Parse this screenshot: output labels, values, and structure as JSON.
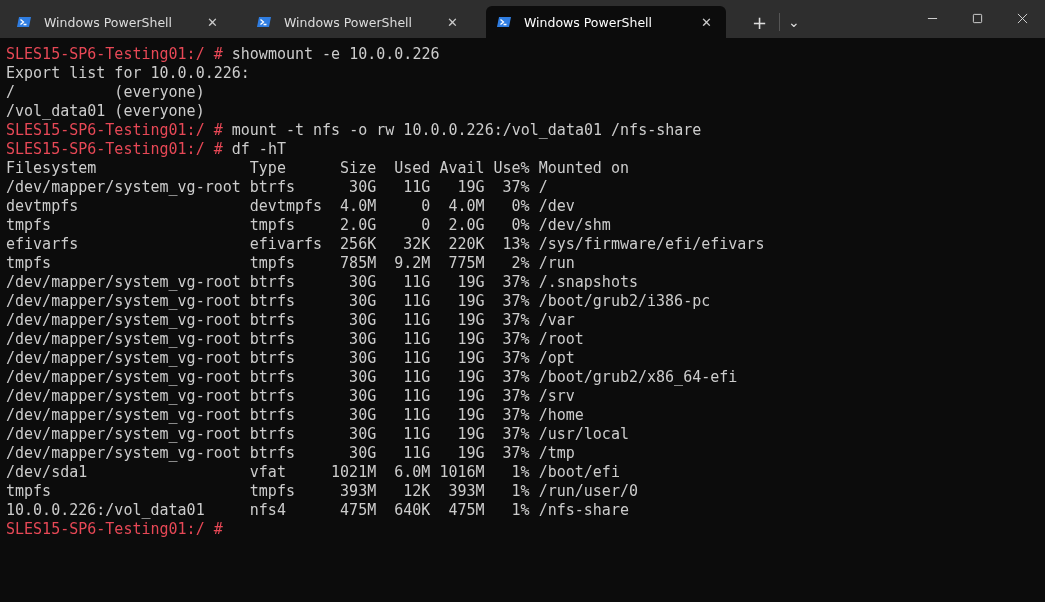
{
  "tabs": [
    {
      "title": "Windows PowerShell",
      "selected": false,
      "close": "✕"
    },
    {
      "title": "Windows PowerShell",
      "selected": false,
      "close": "✕"
    },
    {
      "title": "Windows PowerShell",
      "selected": true,
      "close": "✕"
    }
  ],
  "tab_actions": {
    "new_tab": "+",
    "dropdown": "⌄"
  },
  "terminal": {
    "before": [
      {
        "kind": "prompt",
        "prompt": "SLES15-SP6-Testing01:/ #",
        "command": "showmount -e 10.0.0.226"
      },
      {
        "kind": "output",
        "text": "Export list for 10.0.0.226:"
      },
      {
        "kind": "output",
        "text": "/           (everyone)"
      },
      {
        "kind": "output",
        "text": "/vol_data01 (everyone)"
      },
      {
        "kind": "prompt",
        "prompt": "SLES15-SP6-Testing01:/ #",
        "command": "mount -t nfs -o rw 10.0.0.226:/vol_data01 /nfs-share"
      },
      {
        "kind": "prompt",
        "prompt": "SLES15-SP6-Testing01:/ #",
        "command": "df -hT"
      }
    ],
    "df_table": {
      "columns": [
        "Filesystem",
        "Type",
        "Size",
        "Used",
        "Avail",
        "Use%",
        "Mounted on"
      ],
      "rows": [
        [
          "/dev/mapper/system_vg-root",
          "btrfs",
          "30G",
          "11G",
          "19G",
          "37%",
          "/"
        ],
        [
          "devtmpfs",
          "devtmpfs",
          "4.0M",
          "0",
          "4.0M",
          "0%",
          "/dev"
        ],
        [
          "tmpfs",
          "tmpfs",
          "2.0G",
          "0",
          "2.0G",
          "0%",
          "/dev/shm"
        ],
        [
          "efivarfs",
          "efivarfs",
          "256K",
          "32K",
          "220K",
          "13%",
          "/sys/firmware/efi/efivars"
        ],
        [
          "tmpfs",
          "tmpfs",
          "785M",
          "9.2M",
          "775M",
          "2%",
          "/run"
        ],
        [
          "/dev/mapper/system_vg-root",
          "btrfs",
          "30G",
          "11G",
          "19G",
          "37%",
          "/.snapshots"
        ],
        [
          "/dev/mapper/system_vg-root",
          "btrfs",
          "30G",
          "11G",
          "19G",
          "37%",
          "/boot/grub2/i386-pc"
        ],
        [
          "/dev/mapper/system_vg-root",
          "btrfs",
          "30G",
          "11G",
          "19G",
          "37%",
          "/var"
        ],
        [
          "/dev/mapper/system_vg-root",
          "btrfs",
          "30G",
          "11G",
          "19G",
          "37%",
          "/root"
        ],
        [
          "/dev/mapper/system_vg-root",
          "btrfs",
          "30G",
          "11G",
          "19G",
          "37%",
          "/opt"
        ],
        [
          "/dev/mapper/system_vg-root",
          "btrfs",
          "30G",
          "11G",
          "19G",
          "37%",
          "/boot/grub2/x86_64-efi"
        ],
        [
          "/dev/mapper/system_vg-root",
          "btrfs",
          "30G",
          "11G",
          "19G",
          "37%",
          "/srv"
        ],
        [
          "/dev/mapper/system_vg-root",
          "btrfs",
          "30G",
          "11G",
          "19G",
          "37%",
          "/home"
        ],
        [
          "/dev/mapper/system_vg-root",
          "btrfs",
          "30G",
          "11G",
          "19G",
          "37%",
          "/usr/local"
        ],
        [
          "/dev/mapper/system_vg-root",
          "btrfs",
          "30G",
          "11G",
          "19G",
          "37%",
          "/tmp"
        ],
        [
          "/dev/sda1",
          "vfat",
          "1021M",
          "6.0M",
          "1016M",
          "1%",
          "/boot/efi"
        ],
        [
          "tmpfs",
          "tmpfs",
          "393M",
          "12K",
          "393M",
          "1%",
          "/run/user/0"
        ],
        [
          "10.0.0.226:/vol_data01",
          "nfs4",
          "475M",
          "640K",
          "475M",
          "1%",
          "/nfs-share"
        ]
      ]
    },
    "after": [
      {
        "kind": "prompt",
        "prompt": "SLES15-SP6-Testing01:/ #"
      }
    ]
  }
}
